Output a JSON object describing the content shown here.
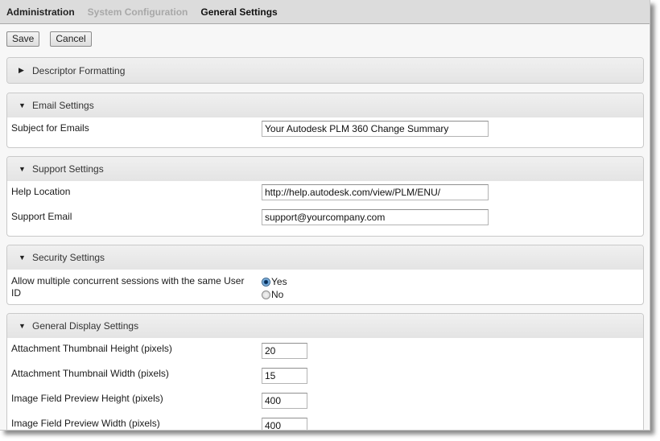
{
  "breadcrumb": [
    "Administration",
    "System Configuration",
    "General Settings"
  ],
  "toolbar": {
    "save_label": "Save",
    "cancel_label": "Cancel"
  },
  "sections": {
    "descriptor": {
      "title": "Descriptor Formatting",
      "expanded": false
    },
    "email": {
      "title": "Email Settings",
      "expanded": true,
      "subject_label": "Subject for Emails",
      "subject_value": "Your Autodesk PLM 360 Change Summary"
    },
    "support": {
      "title": "Support Settings",
      "expanded": true,
      "help_label": "Help Location",
      "help_value": "http://help.autodesk.com/view/PLM/ENU/",
      "email_label": "Support Email",
      "email_value": "support@yourcompany.com"
    },
    "security": {
      "title": "Security Settings",
      "expanded": true,
      "sessions_label": "Allow multiple concurrent sessions with the same User ID",
      "options": [
        "Yes",
        "No"
      ],
      "selected": "Yes"
    },
    "display": {
      "title": "General Display Settings",
      "expanded": true,
      "fields": [
        {
          "label": "Attachment Thumbnail Height (pixels)",
          "value": "20"
        },
        {
          "label": "Attachment Thumbnail Width (pixels)",
          "value": "15"
        },
        {
          "label": "Image Field Preview Height (pixels)",
          "value": "400"
        },
        {
          "label": "Image Field Preview Width (pixels)",
          "value": "400"
        }
      ]
    }
  }
}
